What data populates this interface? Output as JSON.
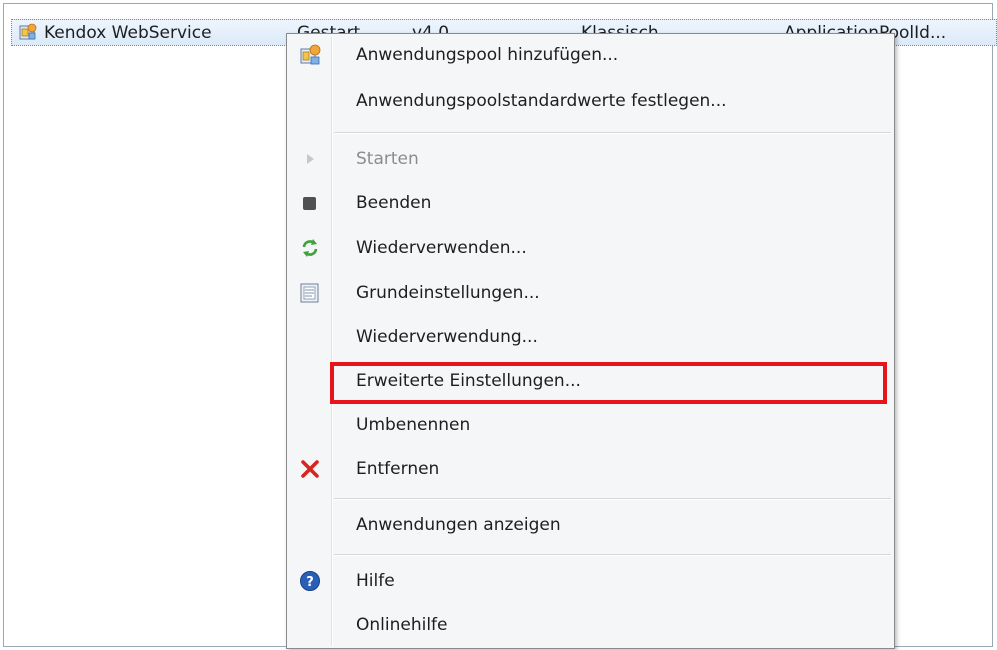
{
  "row": {
    "name": "Kendox WebService",
    "status": "Gestart",
    "version": "v4.0",
    "pipeline": "Klassisch",
    "identity": "ApplicationPoolId..."
  },
  "menu": {
    "items": [
      {
        "label": "Anwendungspool hinzufügen...",
        "icon": "app-pool-add-icon"
      },
      {
        "label": "Anwendungspoolstandardwerte festlegen..."
      },
      {
        "label": "Starten",
        "icon": "play-icon",
        "disabled": true
      },
      {
        "label": "Beenden",
        "icon": "stop-icon"
      },
      {
        "label": "Wiederverwenden...",
        "icon": "recycle-icon"
      },
      {
        "label": "Grundeinstellungen...",
        "icon": "settings-sheet-icon"
      },
      {
        "label": "Wiederverwendung..."
      },
      {
        "label": "Erweiterte Einstellungen..."
      },
      {
        "label": "Umbenennen"
      },
      {
        "label": "Entfernen",
        "icon": "remove-icon"
      },
      {
        "label": "Anwendungen anzeigen"
      },
      {
        "label": "Hilfe",
        "icon": "help-icon"
      },
      {
        "label": "Onlinehilfe"
      }
    ]
  },
  "colors": {
    "highlight": "#e8141b",
    "selection": "#dbeaf9"
  }
}
